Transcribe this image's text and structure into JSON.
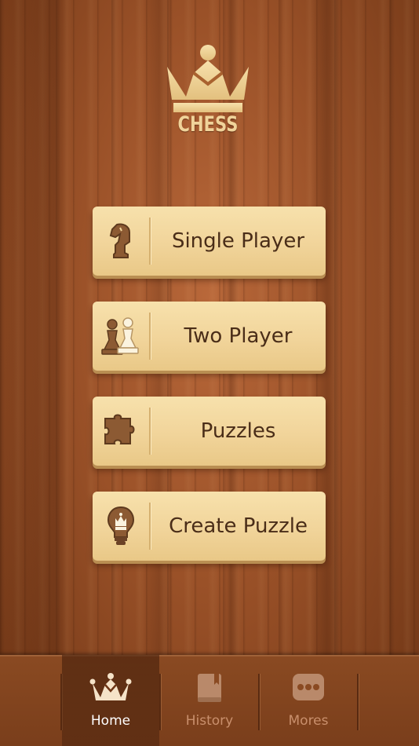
{
  "logo": {
    "text": "CHESS",
    "icon": "crown-icon"
  },
  "menu": {
    "items": [
      {
        "label": "Single Player",
        "icon": "knight-icon"
      },
      {
        "label": "Two Player",
        "icon": "pawns-icon"
      },
      {
        "label": "Puzzles",
        "icon": "puzzle-piece-icon"
      },
      {
        "label": "Create Puzzle",
        "icon": "lightbulb-king-icon"
      }
    ]
  },
  "tabbar": {
    "tabs": [
      {
        "label": "Home",
        "icon": "crown-icon",
        "active": true
      },
      {
        "label": "History",
        "icon": "book-icon",
        "active": false
      },
      {
        "label": "Mores",
        "icon": "more-dots-icon",
        "active": false
      }
    ]
  },
  "colors": {
    "button_face": "#f1d49a",
    "button_text": "#4a2d18",
    "logo_gold": "#f0d39a",
    "tab_active_text": "#ffffff",
    "tab_inactive_text": "#c98f6c"
  }
}
